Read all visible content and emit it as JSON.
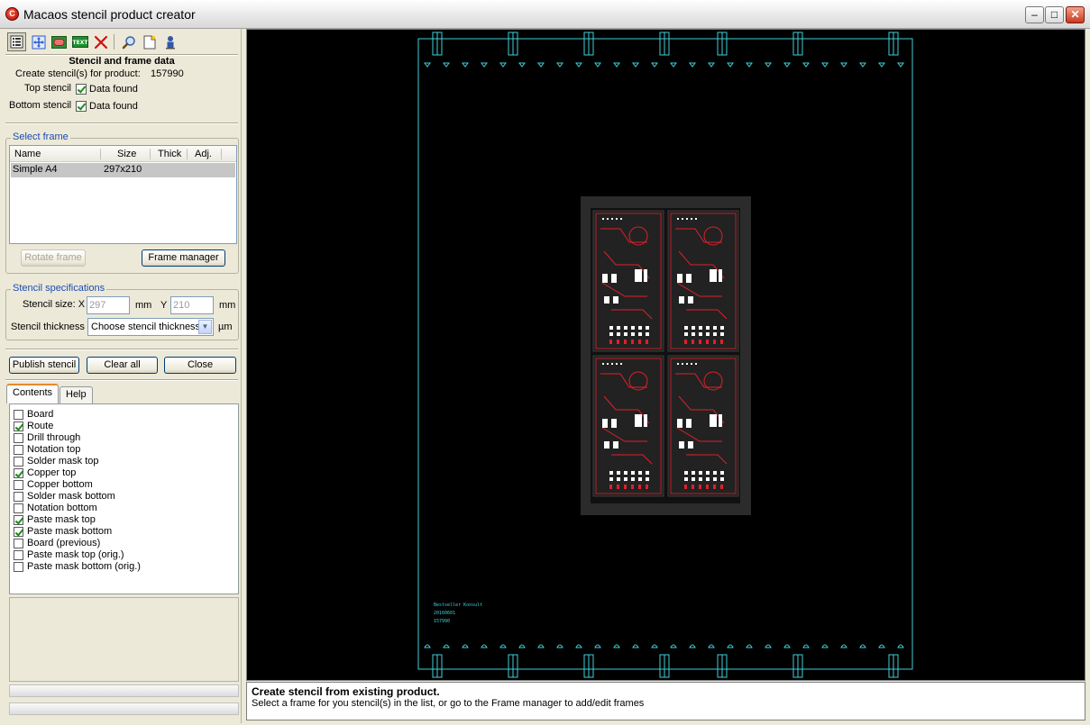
{
  "window": {
    "title": "Macaos stencil product creator",
    "app_icon_letter": "C",
    "minimize_glyph": "–",
    "maximize_glyph": "□",
    "close_glyph": "✕"
  },
  "toolbar": {
    "buttons": [
      "layers-icon",
      "fit-view-icon",
      "board-icon",
      "text-icon",
      "delete-icon",
      "zoom-icon",
      "new-document-icon",
      "user-icon"
    ]
  },
  "stencil_data": {
    "title": "Stencil and frame data",
    "product_label": "Create stencil(s) for product:",
    "product_value": "157990",
    "top_stencil_label": "Top stencil",
    "top_stencil_status": "Data found",
    "bottom_stencil_label": "Bottom stencil",
    "bottom_stencil_status": "Data found"
  },
  "select_frame": {
    "legend": "Select frame",
    "columns": [
      "Name",
      "Size",
      "Thick",
      "Adj."
    ],
    "rows": [
      {
        "name": "Simple A4",
        "size": "297x210",
        "thick": "",
        "adj": ""
      }
    ],
    "rotate_label": "Rotate frame",
    "manager_label": "Frame manager"
  },
  "stencil_spec": {
    "legend": "Stencil specifications",
    "size_label": "Stencil size: X",
    "x_value": "297",
    "x_unit": "mm",
    "y_label": "Y",
    "y_value": "210",
    "y_unit": "mm",
    "thickness_label": "Stencil thickness",
    "thickness_value": "Choose stencil thickness",
    "thickness_unit": "µm"
  },
  "actions": {
    "publish": "Publish stencil",
    "clear": "Clear all",
    "close": "Close"
  },
  "tabs": [
    {
      "label": "Contents",
      "active": true
    },
    {
      "label": "Help",
      "active": false
    }
  ],
  "contents": [
    {
      "label": "Board",
      "checked": false
    },
    {
      "label": "Route",
      "checked": true
    },
    {
      "label": "Drill through",
      "checked": false
    },
    {
      "label": "Notation top",
      "checked": false
    },
    {
      "label": "Solder mask top",
      "checked": false
    },
    {
      "label": "Copper top",
      "checked": true
    },
    {
      "label": "Copper bottom",
      "checked": false
    },
    {
      "label": "Solder mask bottom",
      "checked": false
    },
    {
      "label": "Notation bottom",
      "checked": false
    },
    {
      "label": "Paste mask top",
      "checked": true
    },
    {
      "label": "Paste mask bottom",
      "checked": true
    },
    {
      "label": "Board (previous)",
      "checked": false
    },
    {
      "label": "Paste mask top (orig.)",
      "checked": false
    },
    {
      "label": "Paste mask bottom (orig.)",
      "checked": false
    }
  ],
  "viewer": {
    "frame_color": "#3fd0d8",
    "copper_color": "#e0202a",
    "board_color": "#2b2b2b",
    "text_lines": [
      "Bestseller Konsult",
      "20160601",
      "157990"
    ]
  },
  "status": {
    "title": "Create stencil from existing product.",
    "description": "Select a frame for you stencil(s) in the list, or go to the Frame manager to add/edit frames"
  }
}
